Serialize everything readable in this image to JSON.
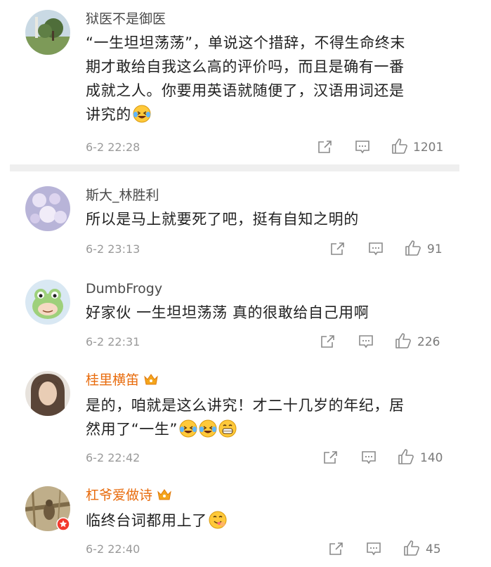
{
  "comments": [
    {
      "username": "狱医不是御医",
      "vip": false,
      "avatar": "landscape-avatar",
      "lines": [
        "“一生坦坦荡荡”，单说这个措辞，不得生命终末",
        "期才敢给自我这么高的评价吗，而且是确有一番",
        "成就之人。你要用英语就随便了，汉语用词还是",
        "讲究的"
      ],
      "emojis": [
        "laugh-cry-emoji"
      ],
      "time": "6-2 22:28",
      "likes": "1201"
    },
    {
      "username": "斯大_林胜利",
      "vip": false,
      "avatar": "flower-avatar",
      "lines": [
        "所以是马上就要死了吧，挺有自知之明的"
      ],
      "emojis": [],
      "time": "6-2 23:13",
      "likes": "91"
    },
    {
      "username": "DumbFrogy",
      "vip": false,
      "avatar": "cartoon-frog-avatar",
      "lines": [
        "好家伙 一生坦坦荡荡 真的很敢给自己用啊"
      ],
      "emojis": [],
      "time": "6-2 22:31",
      "likes": "226"
    },
    {
      "username": "桂里横笛",
      "vip": true,
      "avatar": "portrait-avatar",
      "lines": [
        "是的，咱就是这么讲究！才二十几岁的年纪，居",
        "然用了“一生”"
      ],
      "emojis": [
        "laugh-cry-emoji",
        "laugh-cry-emoji",
        "grin-emoji"
      ],
      "time": "6-2 22:42",
      "likes": "140"
    },
    {
      "username": "杠爷爱做诗",
      "vip": true,
      "avatar": "bird-avatar",
      "lines": [
        "临终台词都用上了"
      ],
      "emojis": [
        "yum-emoji"
      ],
      "time": "6-2 22:40",
      "likes": "45"
    }
  ],
  "colors": {
    "vip_name": "#e86b0c",
    "name": "#4a4a4a",
    "text": "#222222",
    "meta": "#9a9a9a"
  }
}
